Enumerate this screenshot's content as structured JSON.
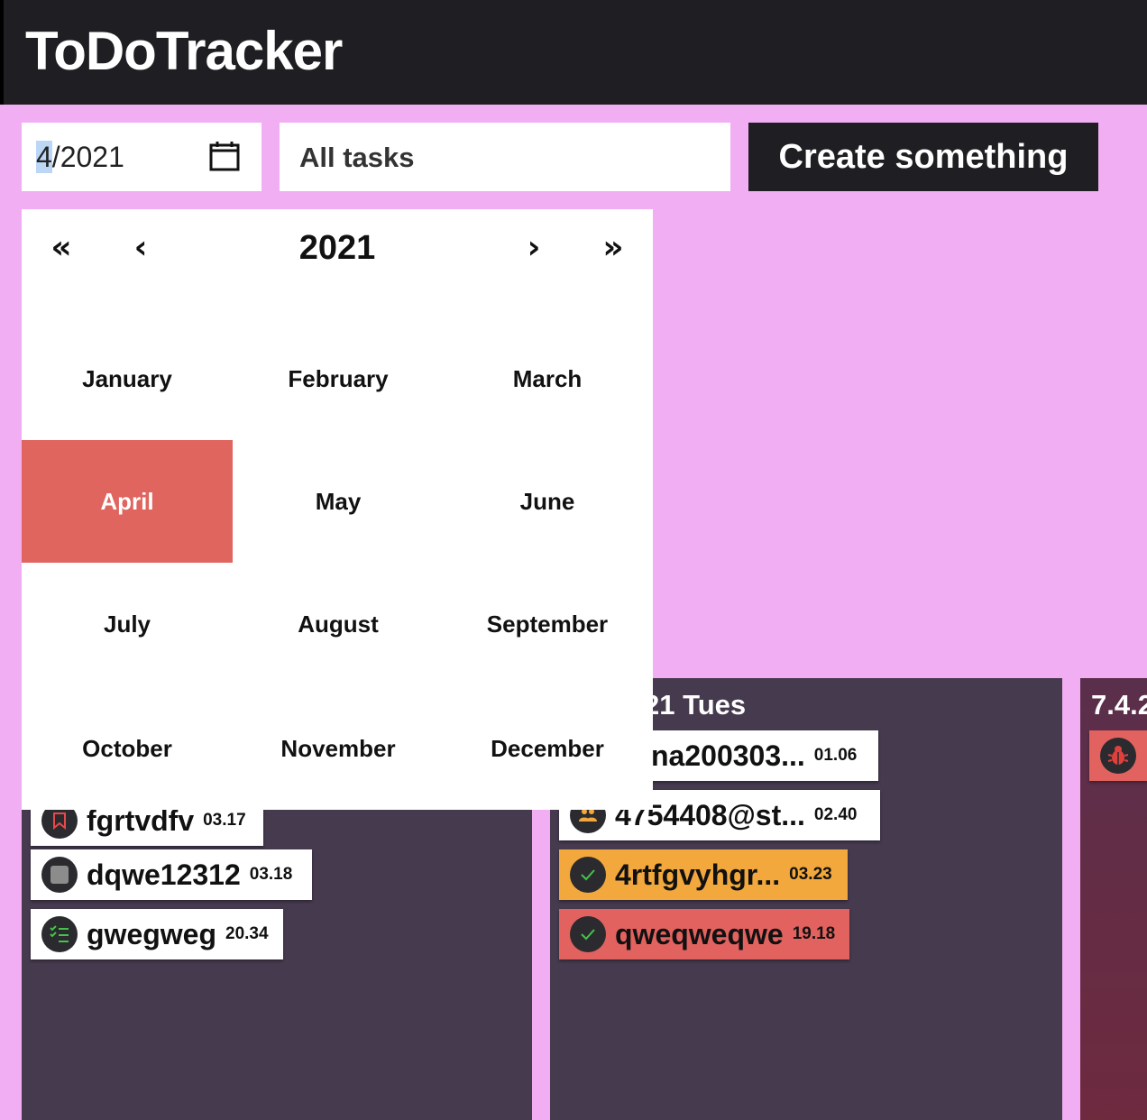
{
  "app": {
    "title": "ToDoTracker"
  },
  "toolbar": {
    "date_month": "4",
    "date_rest": "/2021",
    "filter_label": "All tasks",
    "create_label": "Create something"
  },
  "picker": {
    "prev_year": "«",
    "prev": "‹",
    "year": "2021",
    "next": "›",
    "next_year": "»",
    "selected_month": "April",
    "months": [
      "January",
      "February",
      "March",
      "April",
      "May",
      "June",
      "July",
      "August",
      "September",
      "October",
      "November",
      "December"
    ]
  },
  "columns": [
    {
      "title": "",
      "tasks": [
        {
          "name": "fgrtvdfv",
          "time": "03.17",
          "icon": "bookmark-icon",
          "style": "white"
        },
        {
          "name": "dqwe12312",
          "time": "03.18",
          "icon": "stop-square-icon",
          "style": "white"
        },
        {
          "name": "gwegweg",
          "time": "20.34",
          "icon": "checklist-icon",
          "style": "white"
        }
      ]
    },
    {
      "title": "21 Tues",
      "tasks": [
        {
          "name": "na200303...",
          "time": "01.06",
          "icon": "",
          "style": "white"
        },
        {
          "name": "4754408@st...",
          "time": "02.40",
          "icon": "people-icon",
          "style": "white"
        },
        {
          "name": "4rtfgvyhgr...",
          "time": "03.23",
          "icon": "check-icon",
          "style": "orange"
        },
        {
          "name": "qweqweqwe",
          "time": "19.18",
          "icon": "check-icon",
          "style": "red"
        }
      ]
    },
    {
      "title": "7.4.2",
      "tasks": [
        {
          "name": "",
          "time": "",
          "icon": "bug-icon",
          "style": "red"
        }
      ]
    }
  ],
  "colors": {
    "background": "#f2aef3",
    "header": "#1f1f23",
    "column": "#463a4e",
    "selected_month": "#e0655f",
    "task_orange": "#f2a83c",
    "task_red": "#e2625f"
  }
}
